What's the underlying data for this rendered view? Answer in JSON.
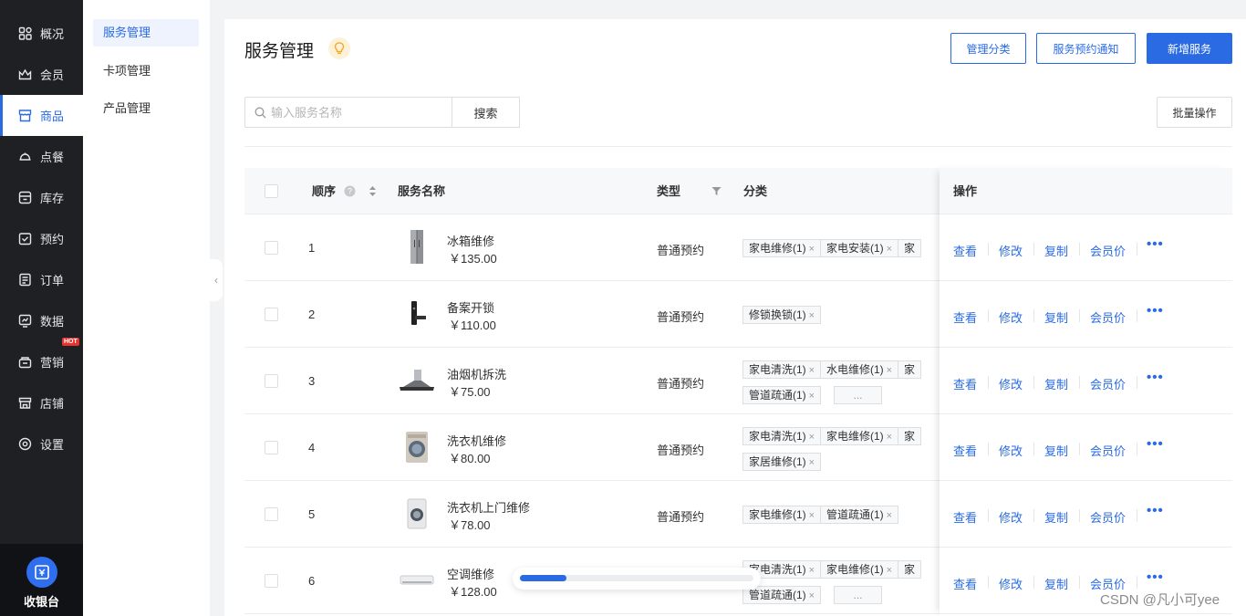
{
  "nav": {
    "items": [
      {
        "label": "概况",
        "icon": "grid-icon"
      },
      {
        "label": "会员",
        "icon": "crown-icon"
      },
      {
        "label": "商品",
        "icon": "store-icon",
        "active": true
      },
      {
        "label": "点餐",
        "icon": "dish-icon"
      },
      {
        "label": "库存",
        "icon": "inventory-icon"
      },
      {
        "label": "预约",
        "icon": "calendar-check-icon"
      },
      {
        "label": "订单",
        "icon": "order-icon"
      },
      {
        "label": "数据",
        "icon": "chart-icon"
      },
      {
        "label": "营销",
        "icon": "marketing-icon",
        "badge": "HOT"
      },
      {
        "label": "店铺",
        "icon": "shop-icon"
      },
      {
        "label": "设置",
        "icon": "settings-icon"
      }
    ],
    "cashier_label": "收银台"
  },
  "subnav": {
    "items": [
      {
        "label": "服务管理",
        "active": true
      },
      {
        "label": "卡项管理"
      },
      {
        "label": "产品管理"
      }
    ]
  },
  "page": {
    "title": "服务管理",
    "buttons": {
      "manage_category": "管理分类",
      "booking_notice": "服务预约通知",
      "add_service": "新增服务",
      "batch": "批量操作"
    },
    "search": {
      "placeholder": "输入服务名称",
      "value": "",
      "button": "搜索"
    }
  },
  "table": {
    "headers": {
      "order": "顺序",
      "name": "服务名称",
      "type": "类型",
      "category": "分类",
      "ops": "操作"
    },
    "rows": [
      {
        "order": "1",
        "name": "冰箱维修",
        "price": "￥135.00",
        "type": "普通预约",
        "image": "fridge",
        "tags": [
          "家电维修(1)",
          "家电安装(1)",
          "家"
        ],
        "more": false
      },
      {
        "order": "2",
        "name": "备案开锁",
        "price": "￥110.00",
        "type": "普通预约",
        "image": "lock",
        "tags": [
          "修锁换锁(1)"
        ],
        "more": false
      },
      {
        "order": "3",
        "name": "油烟机拆洗",
        "price": "￥75.00",
        "type": "普通预约",
        "image": "hood",
        "tags": [
          "家电清洗(1)",
          "水电维修(1)",
          "家",
          "管道疏通(1)"
        ],
        "more": true
      },
      {
        "order": "4",
        "name": "洗衣机维修",
        "price": "￥80.00",
        "type": "普通预约",
        "image": "washer",
        "tags": [
          "家电清洗(1)",
          "家电维修(1)",
          "家",
          "家居维修(1)"
        ],
        "more": false
      },
      {
        "order": "5",
        "name": "洗衣机上门维修",
        "price": "￥78.00",
        "type": "普通预约",
        "image": "washer2",
        "tags": [
          "家电维修(1)",
          "管道疏通(1)"
        ],
        "more": false
      },
      {
        "order": "6",
        "name": "空调维修",
        "price": "￥128.00",
        "type": "普通预约",
        "image": "ac",
        "tags": [
          "家电清洗(1)",
          "家电维修(1)",
          "家",
          "管道疏通(1)"
        ],
        "more": true
      }
    ],
    "tag_close": "×",
    "more_label": "...",
    "actions": {
      "view": "查看",
      "edit": "修改",
      "copy": "复制",
      "member_price": "会员价",
      "more": "•••"
    }
  },
  "loading": {
    "progress": 0.2
  },
  "watermark": "CSDN @凡小可yee",
  "colors": {
    "accent": "#2a6be4",
    "sidebar": "#1f2024",
    "hot": "#e5342f"
  }
}
